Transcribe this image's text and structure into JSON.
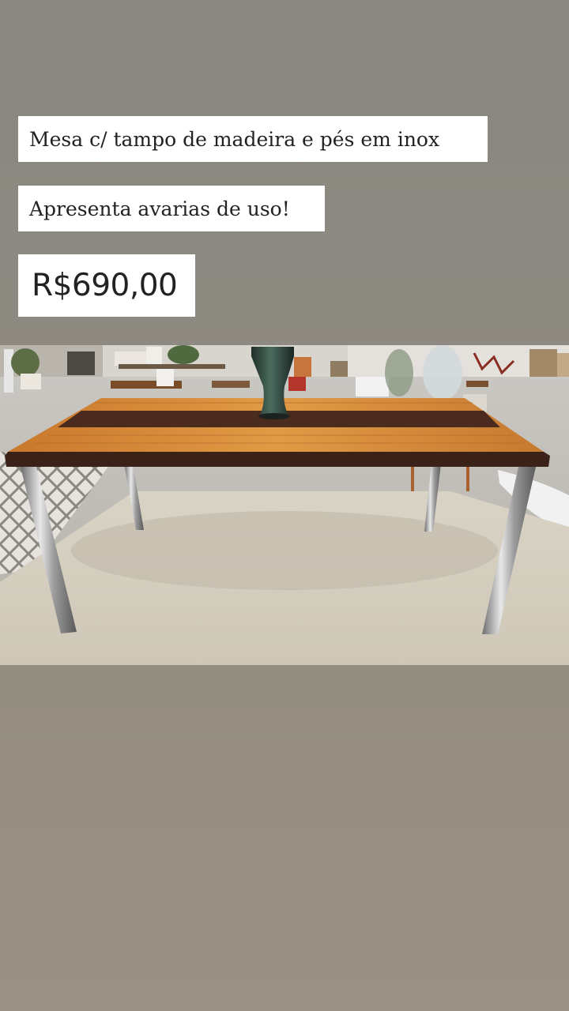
{
  "post": {
    "title": "Mesa c/ tampo de madeira e pés em inox",
    "condition": "Apresenta avarias de uso!",
    "price": "R$690,00"
  },
  "photo": {
    "subject": "wooden-table-photo"
  },
  "colors": {
    "background": "#8c8981",
    "caption_bg": "#ffffff",
    "caption_text": "#222222"
  }
}
